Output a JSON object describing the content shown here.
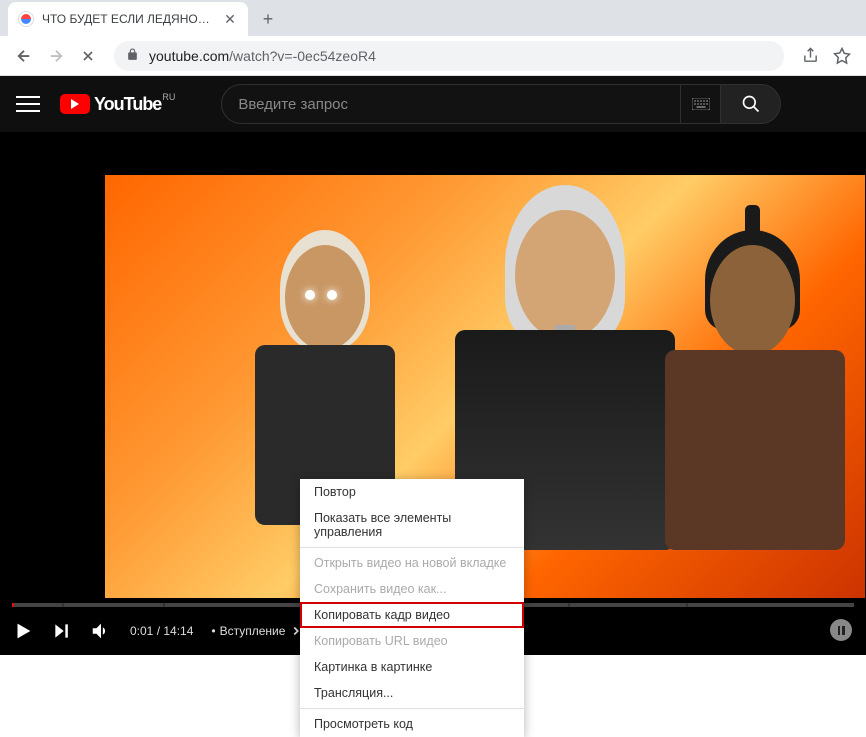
{
  "browser": {
    "tab_title": "ЧТО БУДЕТ ЕСЛИ ЛЕДЯНОЙ Ш",
    "url_domain": "youtube.com",
    "url_path": "/watch?v=-0ec54zeoR4"
  },
  "header": {
    "logo_text": "YouTube",
    "logo_region": "RU",
    "search_placeholder": "Введите запрос"
  },
  "context_menu": {
    "items": [
      {
        "label": "Повтор",
        "disabled": false
      },
      {
        "label": "Показать все элементы управления",
        "disabled": false
      },
      {
        "label": "Открыть видео на новой вкладке",
        "disabled": true
      },
      {
        "label": "Сохранить видео как...",
        "disabled": true
      },
      {
        "label": "Копировать кадр видео",
        "disabled": false,
        "highlighted": true
      },
      {
        "label": "Копировать URL видео",
        "disabled": true
      },
      {
        "label": "Картинка в картинке",
        "disabled": false
      },
      {
        "label": "Трансляция...",
        "disabled": false
      },
      {
        "label": "Просмотреть код",
        "disabled": false
      }
    ]
  },
  "player": {
    "current_time": "0:01",
    "duration": "14:14",
    "chapter": "Вступление"
  }
}
